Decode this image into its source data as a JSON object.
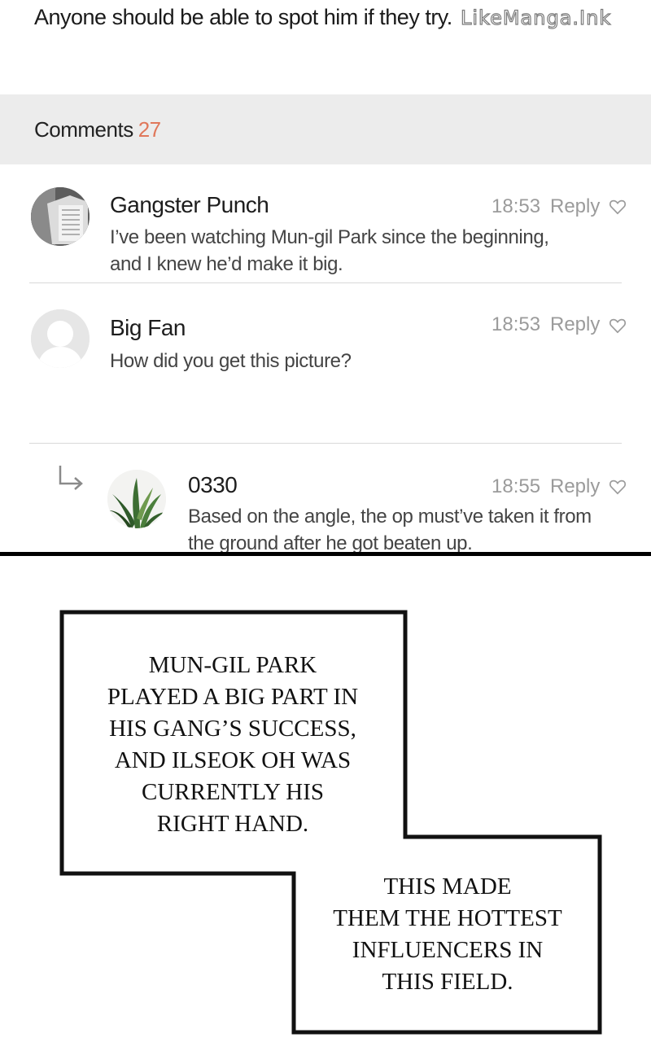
{
  "post": {
    "line": "Anyone should be able to spot him if they try.",
    "watermark": "LikeManga.Ink"
  },
  "comments_header": {
    "label": "Comments",
    "count": "27"
  },
  "comments": [
    {
      "name": "Gangster Punch",
      "time": "18:53",
      "reply": "Reply",
      "lines": [
        "I’ve been watching Mun-gil Park since the beginning,",
        "and I knew he’d make it big."
      ]
    },
    {
      "name": "Big Fan",
      "time": "18:53",
      "reply": "Reply",
      "lines": [
        "How did you get this picture?"
      ]
    },
    {
      "name": "0330",
      "time": "18:55",
      "reply": "Reply",
      "lines": [
        "Based on the angle, the op must’ve taken it from",
        "the ground after he got beaten up."
      ]
    }
  ],
  "narration": {
    "box1": [
      "MUN-GIL PARK",
      "PLAYED A BIG PART IN",
      "HIS GANG’S SUCCESS,",
      "AND ILSEOK OH WAS",
      "CURRENTLY HIS",
      "RIGHT HAND."
    ],
    "box2": [
      "THIS MADE",
      "THEM THE HOTTEST",
      "INFLUENCERS IN",
      "THIS FIELD."
    ]
  },
  "colors": {
    "count_accent": "#e0775a",
    "header_bg": "#ececec",
    "meta_text": "#9b9b9b"
  }
}
